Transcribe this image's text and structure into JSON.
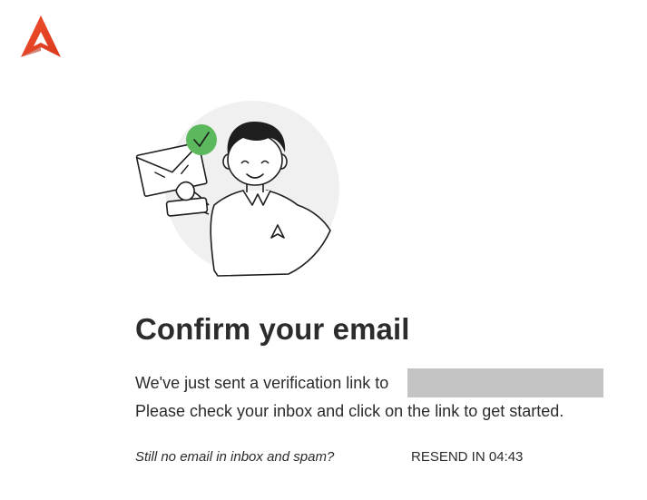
{
  "brand": {
    "logo_icon": "a-logo-icon",
    "accent_color": "#e8462a",
    "success_color": "#5cb85c"
  },
  "illustration": {
    "icon": "person-holding-envelope-illustration"
  },
  "content": {
    "title": "Confirm your email",
    "line1": "We've just sent a verification link to",
    "line2": "Please check your inbox and click on the link to get started."
  },
  "footer": {
    "still_text": "Still no email in inbox and spam?",
    "resend_label": "RESEND IN 04:43"
  }
}
